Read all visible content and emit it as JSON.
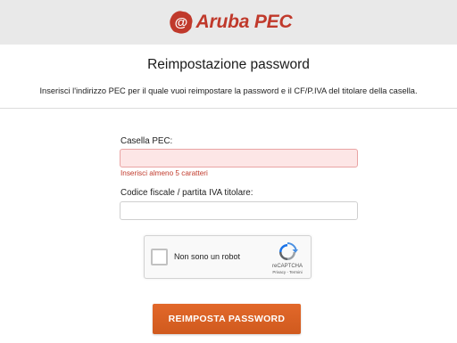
{
  "header": {
    "logo_text": "Aruba PEC"
  },
  "page": {
    "title": "Reimpostazione password",
    "subtitle": "Inserisci l'indirizzo PEC per il quale vuoi reimpostare la password e il CF/P.IVA del titolare della casella."
  },
  "form": {
    "pec_label": "Casella PEC:",
    "pec_value": "",
    "pec_error": "Inserisci almeno 5 caratteri",
    "cf_label": "Codice fiscale / partita IVA titolare:",
    "cf_value": ""
  },
  "recaptcha": {
    "label": "Non sono un robot",
    "brand": "reCAPTCHA",
    "terms": "Privacy - Termini"
  },
  "submit_label": "REIMPOSTA PASSWORD",
  "colors": {
    "brand": "#c0392b",
    "button": "#d9622a",
    "error_bg": "#fde6e6"
  }
}
